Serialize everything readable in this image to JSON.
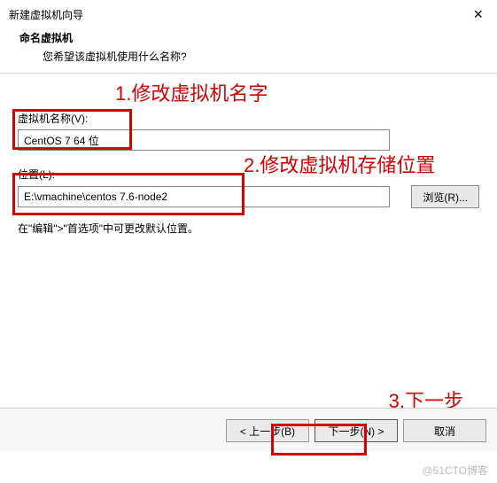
{
  "window": {
    "title": "新建虚拟机向导",
    "close_symbol": "×"
  },
  "header": {
    "heading": "命名虚拟机",
    "subheading": "您希望该虚拟机使用什么名称?"
  },
  "annotations": {
    "a1": "1.修改虚拟机名字",
    "a2": "2.修改虚拟机存储位置",
    "a3": "3.下一步",
    "color": "#d60000"
  },
  "fields": {
    "name_label": "虚拟机名称(V):",
    "name_value": "CentOS 7 64 位",
    "location_label": "位置(L):",
    "location_value": "E:\\vmachine\\centos 7.6-node2",
    "browse_label": "浏览(R)..."
  },
  "hint": "在\"编辑\">\"首选项\"中可更改默认位置。",
  "buttons": {
    "back": "< 上一步(B)",
    "next": "下一步(N) >",
    "cancel": "取消"
  },
  "watermark": "@51CTO博客"
}
